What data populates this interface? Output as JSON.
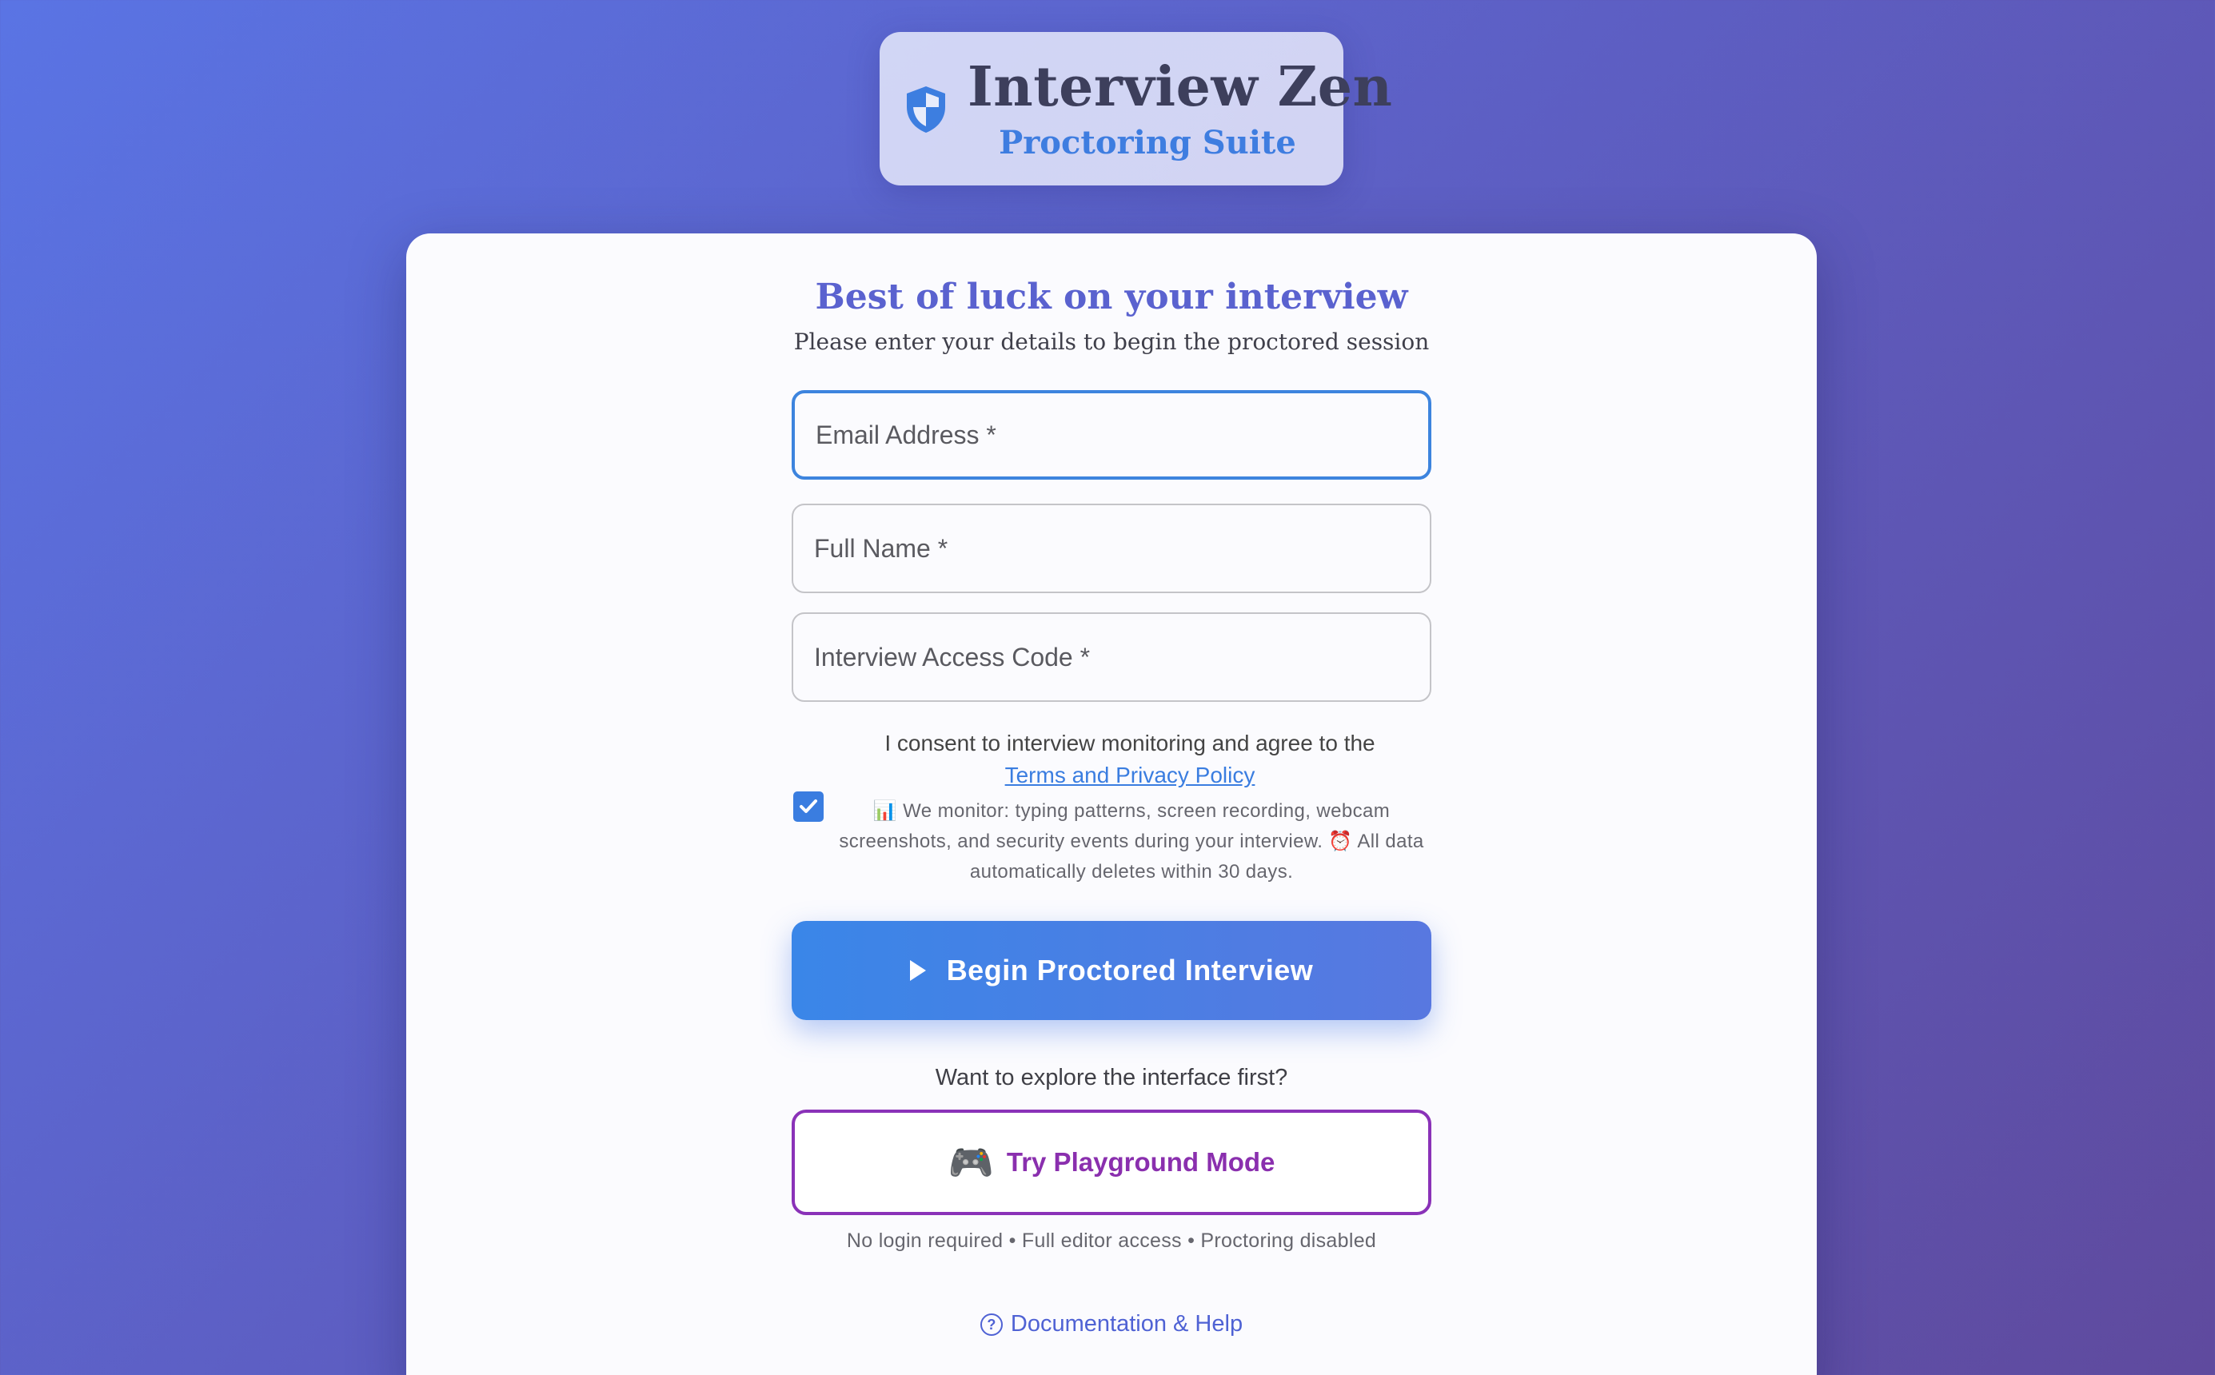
{
  "brand": {
    "title": "Interview Zen",
    "subtitle": "Proctoring Suite",
    "icon": "shield-icon"
  },
  "card": {
    "heading": "Best of luck on your interview",
    "subheading": "Please enter your details to begin the proctored session"
  },
  "form": {
    "email_placeholder": "Email Address *",
    "name_placeholder": "Full Name *",
    "code_placeholder": "Interview Access Code *",
    "email_value": "",
    "name_value": "",
    "code_value": ""
  },
  "consent": {
    "checked": true,
    "text": "I consent to interview monitoring and agree to the",
    "link": "Terms and Privacy Policy",
    "monitor_info": "📊 We monitor: typing patterns, screen recording, webcam screenshots, and security events during your interview. ⏰ All data automatically deletes within 30 days."
  },
  "actions": {
    "begin_label": "Begin Proctored Interview",
    "explore_question": "Want to explore the interface first?",
    "playground_emoji": "🎮",
    "playground_label": "Try Playground Mode",
    "playground_note": "No login required • Full editor access • Proctoring disabled",
    "docs_label": "Documentation & Help"
  },
  "colors": {
    "accent": "#3d84de",
    "heading": "#5a62cf",
    "playground": "#8a32b8",
    "background_start": "#5a74e4",
    "background_end": "#5f4a9e"
  }
}
